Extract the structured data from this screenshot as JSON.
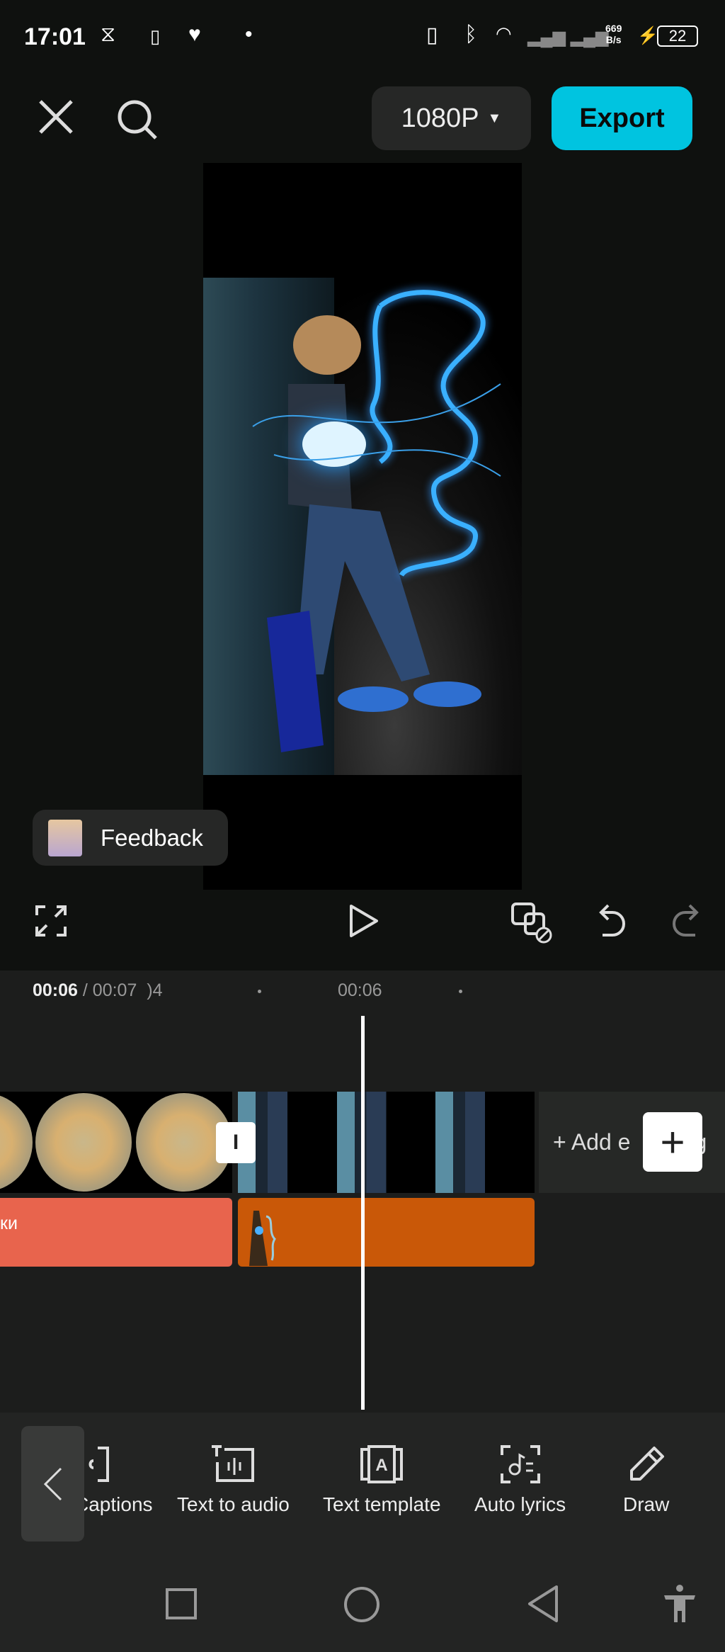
{
  "status_bar": {
    "time": "17:01",
    "net_speed_value": "669",
    "net_speed_unit": "B/s",
    "battery": "22",
    "icons": [
      "capcut-icon",
      "media-icon",
      "heart-icon",
      "dot-icon",
      "vibrate-icon",
      "bluetooth-icon",
      "wifi-icon",
      "signal-icon",
      "charging-icon",
      "battery-icon"
    ]
  },
  "header": {
    "close_icon": "close-icon",
    "search_icon": "search-icon",
    "resolution": "1080P",
    "export_label": "Export",
    "accent": "#00c4e0"
  },
  "preview": {
    "feedback_label": "Feedback"
  },
  "controls": {
    "icons": [
      "fullscreen-icon",
      "play-icon",
      "keyframe-icon",
      "undo-icon",
      "redo-icon"
    ]
  },
  "timeline": {
    "current_time": "00:06",
    "separator": " / ",
    "total_time": "00:07",
    "partial_tick": ")4",
    "tick_label": "00:06",
    "add_ending_label": "+ Add e",
    "add_ending_tail": "g",
    "text_clip_label": "ки",
    "text_clip_color": "#e8644d",
    "sticker_clip_color": "#c95808"
  },
  "toolbar": {
    "items": [
      {
        "label": "Captions",
        "visible": "aptions",
        "icon": "captions-icon"
      },
      {
        "label": "Text to audio",
        "icon": "text-to-audio-icon"
      },
      {
        "label": "Text template",
        "icon": "text-template-icon"
      },
      {
        "label": "Auto lyrics",
        "icon": "auto-lyrics-icon"
      },
      {
        "label": "Draw",
        "icon": "draw-icon"
      }
    ]
  },
  "nav_bar": {
    "icons": [
      "recents-icon",
      "home-icon",
      "back-icon",
      "accessibility-icon"
    ]
  }
}
